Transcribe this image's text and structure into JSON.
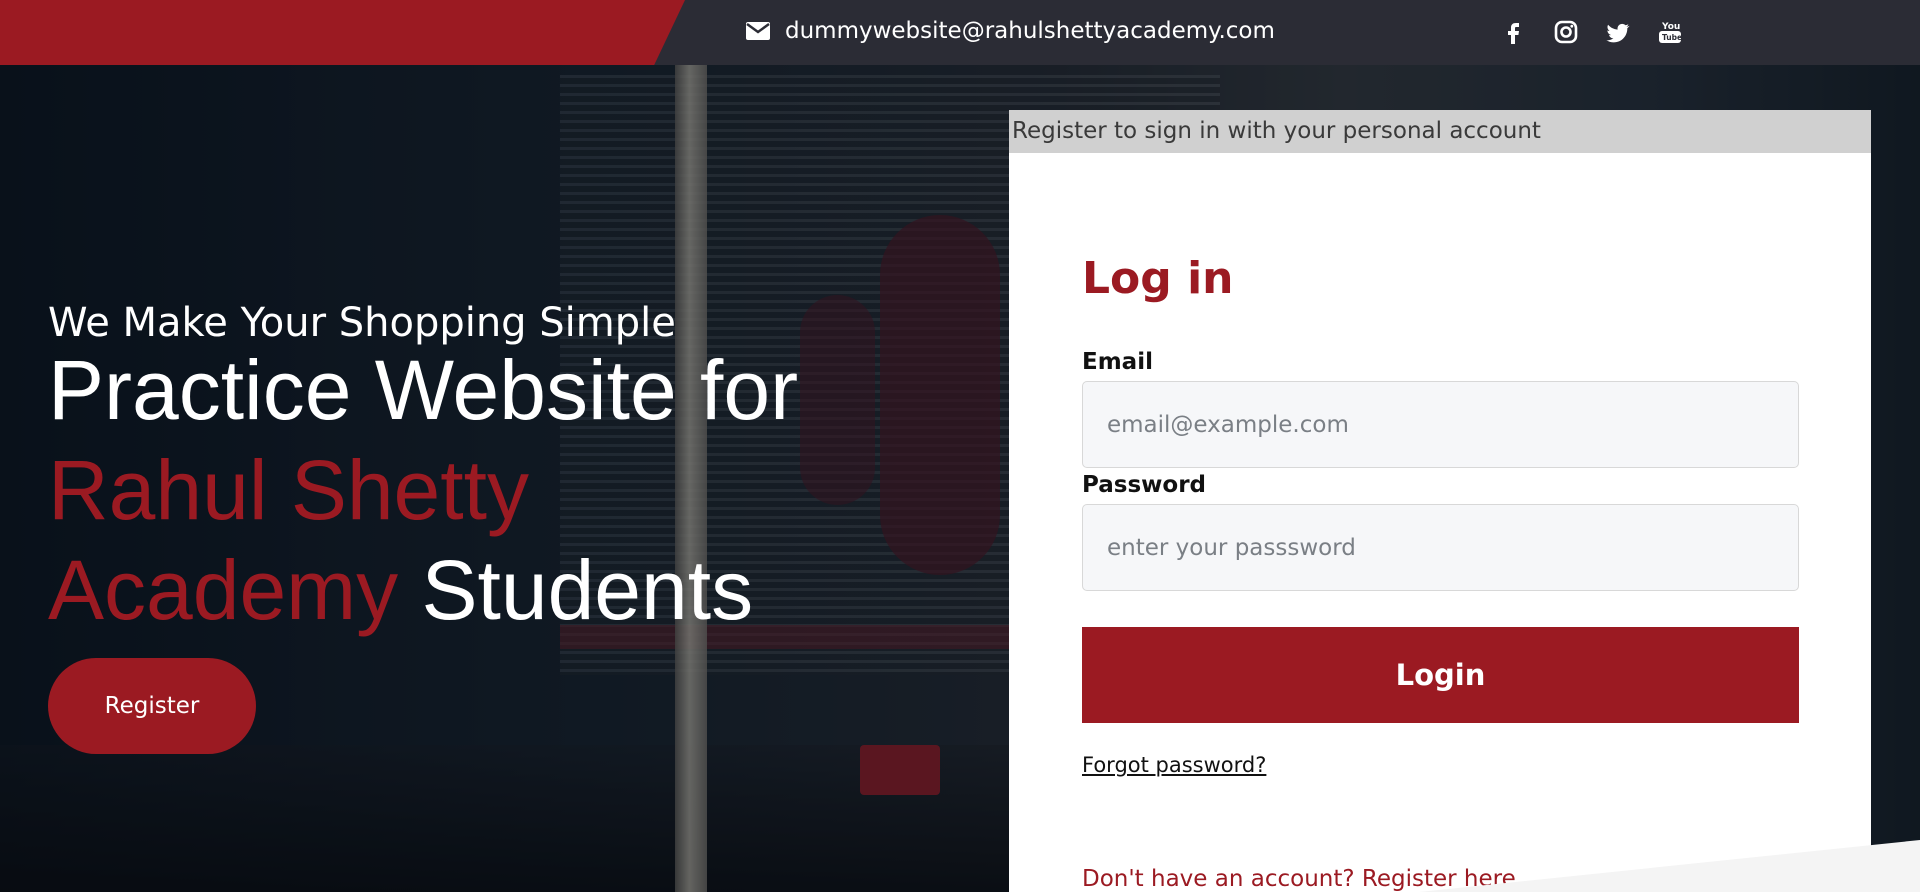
{
  "topbar": {
    "email": "dummywebsite@rahulshettyacademy.com",
    "icons": [
      "envelope-icon",
      "facebook-icon",
      "instagram-icon",
      "twitter-icon",
      "youtube-icon"
    ]
  },
  "hero": {
    "tagline": "We Make Your Shopping Simple",
    "headline_line1": "Practice Website for",
    "headline_red1": "Rahul Shetty",
    "headline_red2": "Academy",
    "headline_white2": "Students",
    "register_label": "Register"
  },
  "login": {
    "header_text": "Register to sign in with your personal account",
    "title": "Log in",
    "email_label": "Email",
    "email_placeholder": "email@example.com",
    "password_label": "Password",
    "password_placeholder": "enter your passsword",
    "login_button": "Login",
    "forgot_link": "Forgot password?",
    "signup_text": "Don't have an account? Register here"
  },
  "colors": {
    "brand_red": "#9b1a22",
    "topbar_dark": "#2b2c35"
  }
}
